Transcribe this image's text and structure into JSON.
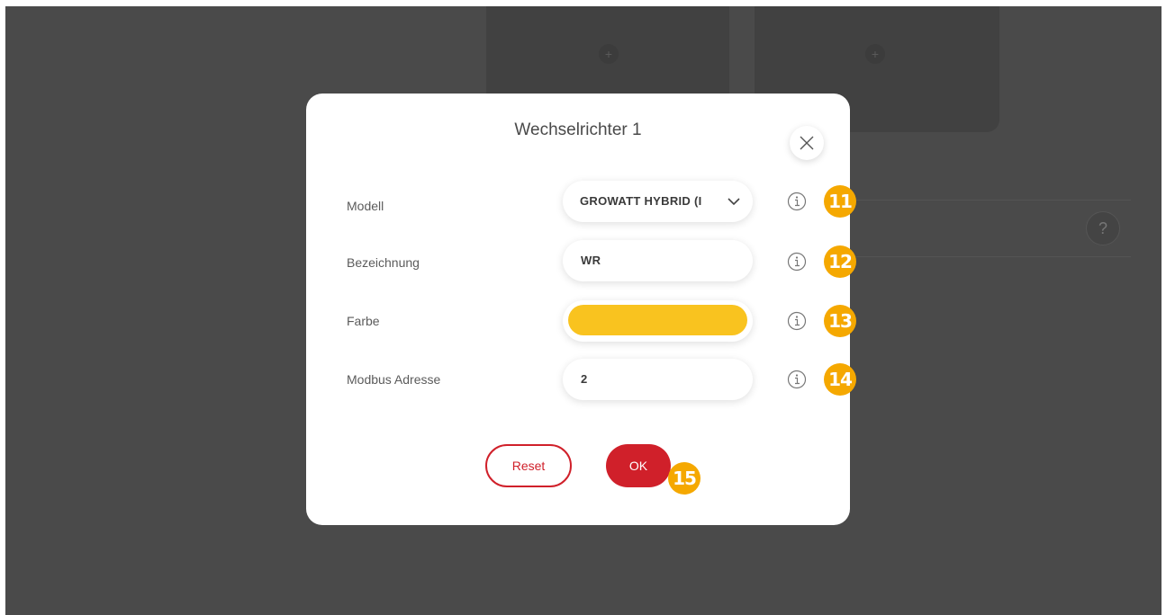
{
  "dialog": {
    "title": "Wechselrichter 1",
    "close_icon": "close-icon"
  },
  "fields": {
    "model": {
      "label": "Modell",
      "value": "GROWATT HYBRID (I",
      "icon": "chevron-down-icon"
    },
    "name": {
      "label": "Bezeichnung",
      "value": "WR"
    },
    "color": {
      "label": "Farbe",
      "value_color": "#f9c31f"
    },
    "modbus": {
      "label": "Modbus Adresse",
      "value": "2"
    }
  },
  "info_icon": "info-icon",
  "badges": [
    "11",
    "12",
    "13",
    "14",
    "15"
  ],
  "buttons": {
    "reset": "Reset",
    "ok": "OK"
  },
  "background": {
    "help_label": "?",
    "plus_label": "+"
  },
  "colors": {
    "accent_red": "#d0202a",
    "badge_orange": "#f5a800",
    "overlay": "#4a4a4a"
  }
}
